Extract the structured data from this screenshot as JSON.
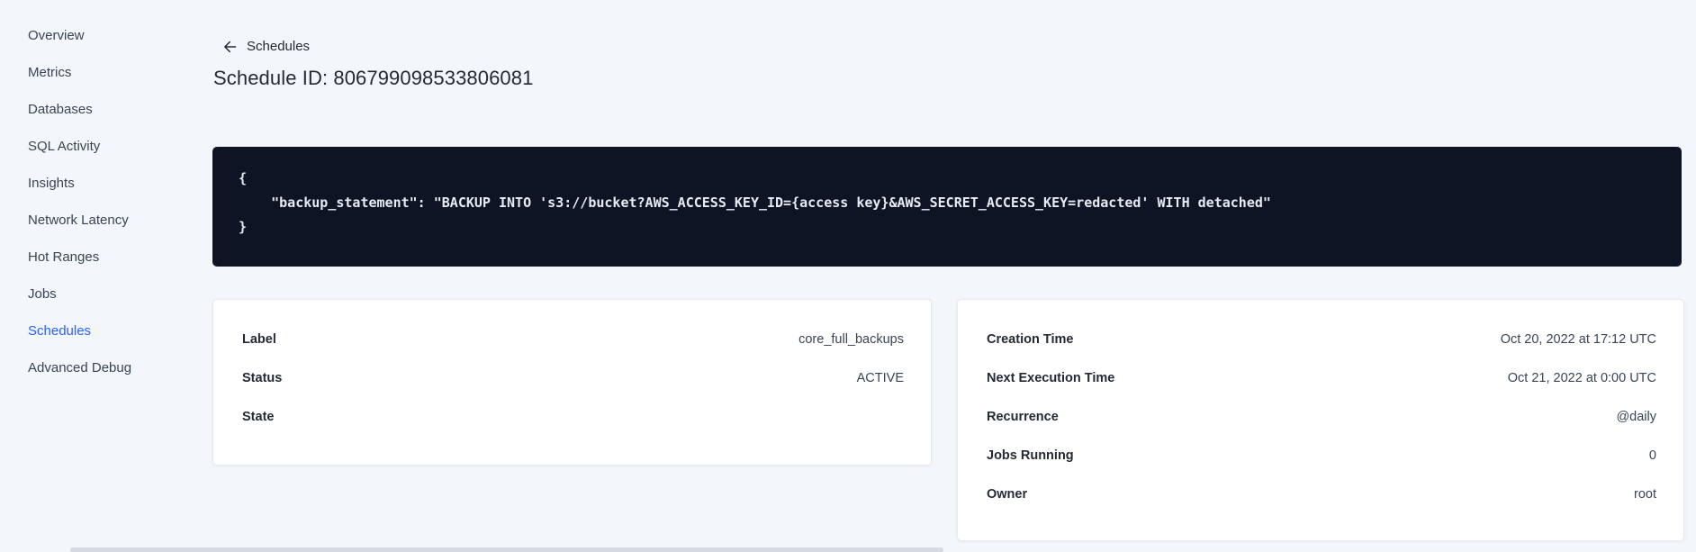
{
  "app": {
    "page_background": "#f3f6fa",
    "accent_color": "#2962ff"
  },
  "sidebar": {
    "text_color": "#394455",
    "active_color": "#2962ff",
    "active_item": "Schedules",
    "items": [
      {
        "label": "Overview"
      },
      {
        "label": "Metrics"
      },
      {
        "label": "Databases"
      },
      {
        "label": "SQL Activity"
      },
      {
        "label": "Insights"
      },
      {
        "label": "Network Latency"
      },
      {
        "label": "Hot Ranges"
      },
      {
        "label": "Jobs"
      },
      {
        "label": "Schedules"
      },
      {
        "label": "Advanced Debug"
      }
    ]
  },
  "header": {
    "back_link": {
      "icon": "arrow-left-icon",
      "label": "Schedules"
    },
    "title": "Schedule ID: 806799098533806081"
  },
  "code_block": {
    "background": "#0e1423",
    "text_color": "#e7ecf4",
    "lines": [
      "{",
      "    \"backup_statement\": \"BACKUP INTO 's3://bucket?AWS_ACCESS_KEY_ID={access key}&AWS_SECRET_ACCESS_KEY=redacted' WITH detached\"",
      "}"
    ]
  },
  "schedule_details": {
    "left_card": {
      "rows": [
        {
          "label": "Label",
          "value": "core_full_backups"
        },
        {
          "label": "Status",
          "value": "ACTIVE"
        },
        {
          "label": "State",
          "value": ""
        }
      ]
    },
    "right_card": {
      "rows": [
        {
          "label": "Creation Time",
          "value": "Oct 20, 2022 at 17:12 UTC"
        },
        {
          "label": "Next Execution Time",
          "value": "Oct 21, 2022 at 0:00 UTC"
        },
        {
          "label": "Recurrence",
          "value": "@daily"
        },
        {
          "label": "Jobs Running",
          "value": "0"
        },
        {
          "label": "Owner",
          "value": "root"
        }
      ]
    }
  }
}
